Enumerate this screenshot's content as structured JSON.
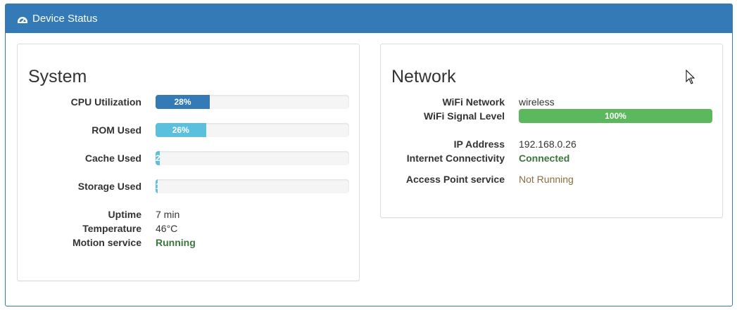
{
  "header": {
    "title": "Device Status",
    "icon": "dashboard-gauge-icon"
  },
  "system": {
    "title": "System",
    "cpu": {
      "label": "CPU Utilization",
      "percent": 28,
      "text": "28%",
      "color": "#337ab7"
    },
    "rom": {
      "label": "ROM Used",
      "percent": 26,
      "text": "26%",
      "color": "#5bc0de"
    },
    "cache": {
      "label": "Cache Used",
      "percent": 2,
      "text": "2%",
      "color": "#5bc0de"
    },
    "storage": {
      "label": "Storage Used",
      "percent": 1,
      "text": "1%",
      "color": "#5bc0de"
    },
    "uptime": {
      "label": "Uptime",
      "value": "7 min"
    },
    "temperature": {
      "label": "Temperature",
      "value": "46°C"
    },
    "motion": {
      "label": "Motion service",
      "value": "Running"
    }
  },
  "network": {
    "title": "Network",
    "wifi_network": {
      "label": "WiFi Network",
      "value": "wireless"
    },
    "wifi_signal": {
      "label": "WiFi Signal Level",
      "percent": 100,
      "text": "100%",
      "color": "#5cb85c"
    },
    "ip": {
      "label": "IP Address",
      "value": "192.168.0.26"
    },
    "internet": {
      "label": "Internet Connectivity",
      "value": "Connected"
    },
    "access_point": {
      "label": "Access Point service",
      "value": "Not Running"
    }
  },
  "colors": {
    "primary": "#337ab7",
    "success_text": "#3c763d",
    "warning_text": "#8a6d3b"
  }
}
